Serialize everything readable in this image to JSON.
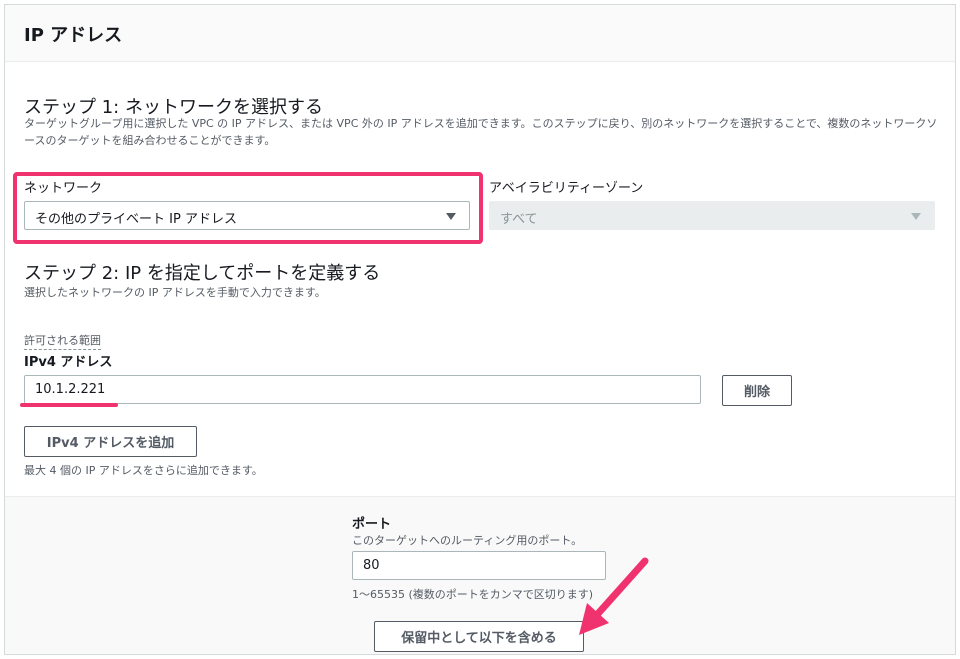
{
  "panel": {
    "title": "IP アドレス"
  },
  "step1": {
    "title": "ステップ 1: ネットワークを選択する",
    "description": "ターゲットグループ用に選択した VPC の IP アドレス、または VPC 外の IP アドレスを追加できます。このステップに戻り、別のネットワークを選択することで、複数のネットワークソースのターゲットを組み合わせることができます。",
    "network_label": "ネットワーク",
    "network_value": "その他のプライベート IP アドレス",
    "az_label": "アベイラビリティーゾーン",
    "az_value": "すべて"
  },
  "step2": {
    "title": "ステップ 2: IP を指定してポートを定義する",
    "description": "選択したネットワークの IP アドレスを手動で入力できます。",
    "permitted_range": "許可される範囲",
    "ipv4_label": "IPv4 アドレス",
    "ipv4_value": "10.1.2.221",
    "remove_button": "削除",
    "add_button": "IPv4 アドレスを追加",
    "add_hint": "最大 4 個の IP アドレスをさらに追加できます。"
  },
  "port": {
    "label": "ポート",
    "description": "このターゲットへのルーティング用のポート。",
    "value": "80",
    "hint": "1〜65535 (複数のポートをカンマで区切ります)",
    "include_button": "保留中として以下を含める"
  },
  "colors": {
    "accent": "#f0336e",
    "border": "#aab7b8",
    "muted_text": "#545b64"
  }
}
